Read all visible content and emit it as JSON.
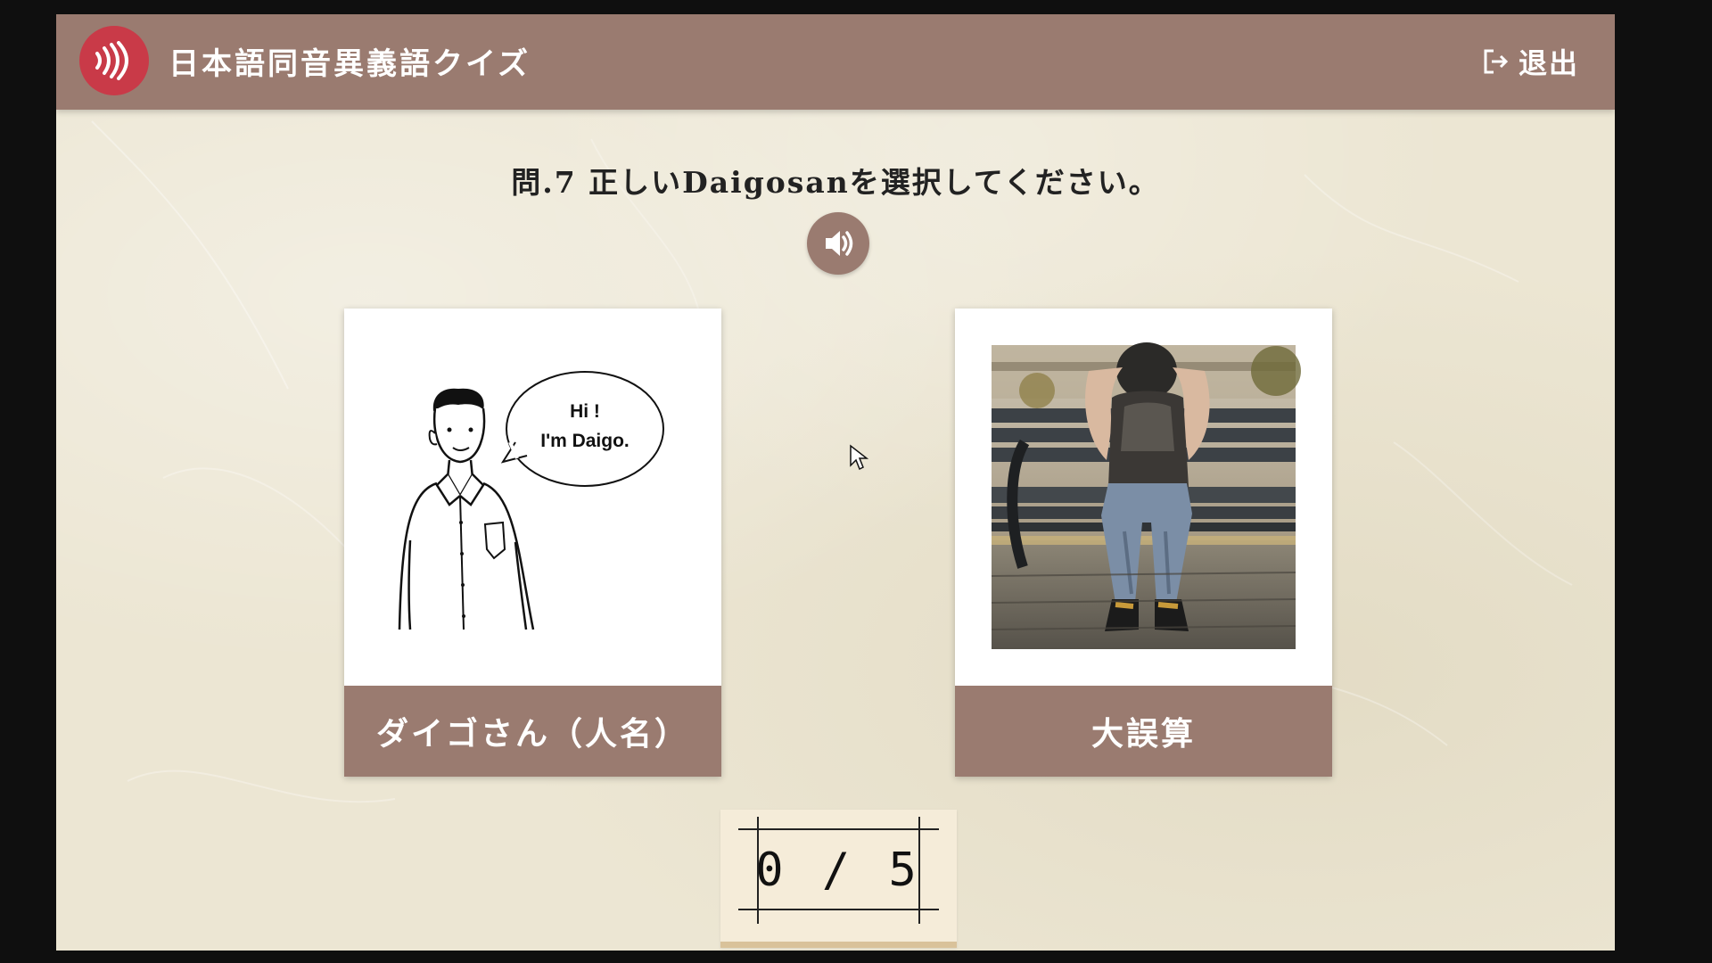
{
  "header": {
    "title": "日本語同音異義語クイズ",
    "exit_label": "退出",
    "logo_icon": "sound-waves-icon",
    "exit_icon": "logout-icon"
  },
  "question": {
    "text": "問.7 正しいDaigosanを選択してください。",
    "audio_icon": "speaker-icon"
  },
  "options": [
    {
      "label": "ダイゴさん（人名）",
      "speech_line1": "Hi !",
      "speech_line2": "I'm Daigo."
    },
    {
      "label": "大誤算"
    }
  ],
  "score": {
    "text": "0 / 5"
  },
  "colors": {
    "header": "#9a7b70",
    "logo": "#c93a48",
    "background": "#ece6d3",
    "card_label": "#9a7b70"
  }
}
